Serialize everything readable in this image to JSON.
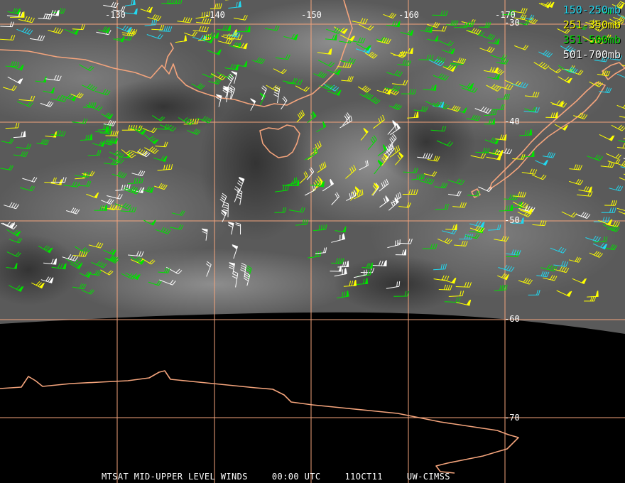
{
  "legend": [
    {
      "label": "150-250mb",
      "color": "#22d8f0"
    },
    {
      "label": "251-350mb",
      "color": "#ffff00"
    },
    {
      "label": "351-500mb",
      "color": "#00e000"
    },
    {
      "label": "501-700mb",
      "color": "#ffffff"
    }
  ],
  "longitude_labels": [
    "-130",
    "-140",
    "-150",
    "-160",
    "-170"
  ],
  "latitude_labels": [
    "-30",
    "-40",
    "-50",
    "-60",
    "-70"
  ],
  "footer": {
    "product": "MTSAT MID-UPPER LEVEL WINDS",
    "time": "00:00 UTC",
    "date": "11OCT11",
    "source": "UW-CIMSS"
  },
  "colors": {
    "grid": "#f4a47c",
    "coast": "#f4a47c",
    "space": "#000000"
  }
}
